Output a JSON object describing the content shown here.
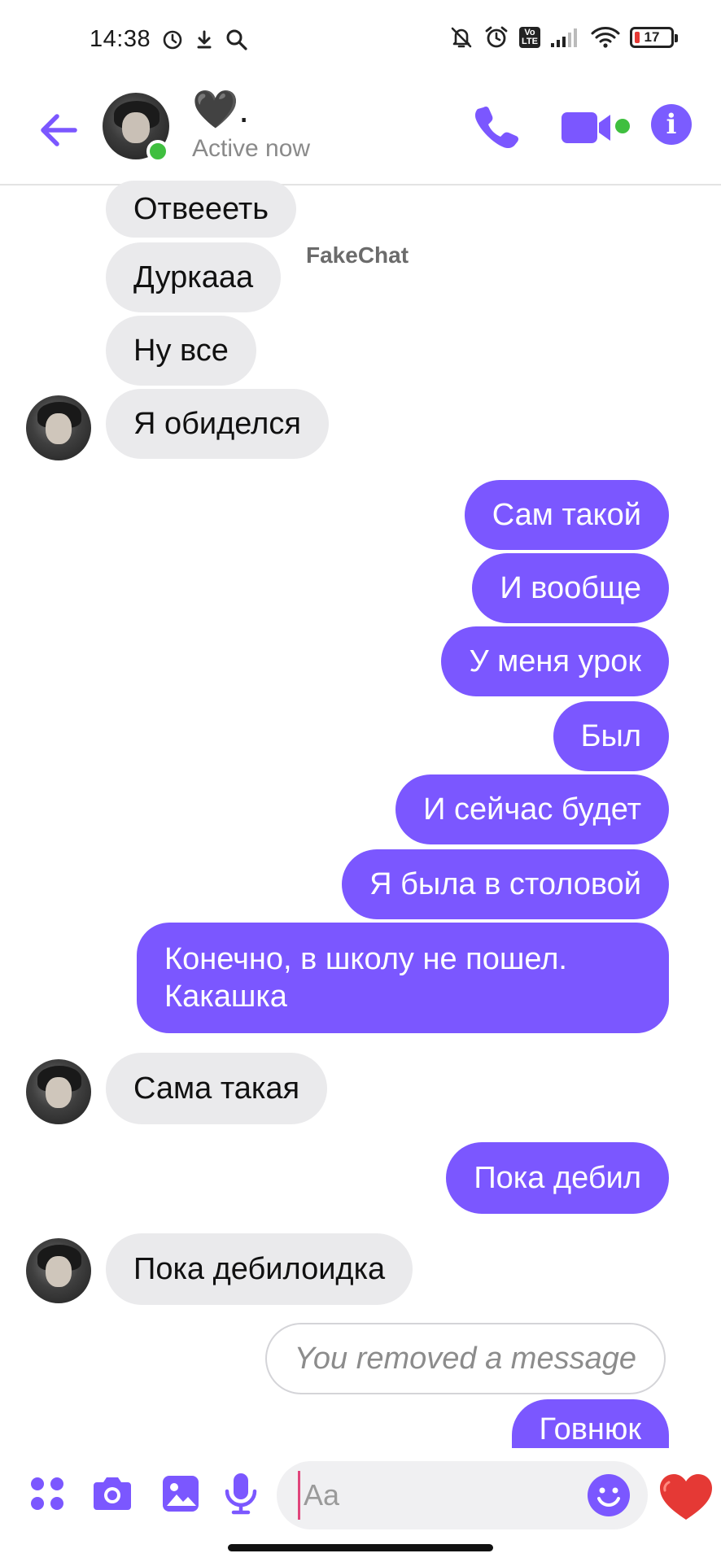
{
  "status_bar": {
    "time": "14:38",
    "battery": "17"
  },
  "header": {
    "contact_name": "🖤.",
    "contact_status": "Active now",
    "watermark": "FakeChat"
  },
  "colors": {
    "accent": "#7b57ff",
    "incoming_bubble": "#eaeaec",
    "online": "#3fbf3f"
  },
  "messages": [
    {
      "side": "in",
      "text": "Отвеееть"
    },
    {
      "side": "in",
      "text": "Дуркааа"
    },
    {
      "side": "in",
      "text": "Ну все"
    },
    {
      "side": "in",
      "text": "Я обиделся",
      "avatar": true
    },
    {
      "side": "out",
      "text": "Сам такой"
    },
    {
      "side": "out",
      "text": "И вообще"
    },
    {
      "side": "out",
      "text": "У меня урок"
    },
    {
      "side": "out",
      "text": "Был"
    },
    {
      "side": "out",
      "text": "И сейчас будет"
    },
    {
      "side": "out",
      "text": "Я была в столовой"
    },
    {
      "side": "out",
      "text": "Конечно, в школу не пошел.\nКакашка"
    },
    {
      "side": "in",
      "text": "Сама такая",
      "avatar": true
    },
    {
      "side": "out",
      "text": "Пока дебил"
    },
    {
      "side": "in",
      "text": "Пока дебилоидка",
      "avatar": true
    },
    {
      "side": "removed",
      "text": "You removed a message"
    },
    {
      "side": "out",
      "text": "Говнюк"
    }
  ],
  "composer": {
    "placeholder": "Aa",
    "icons": [
      "apps-icon",
      "camera-icon",
      "gallery-icon",
      "microphone-icon",
      "emoji-icon",
      "heart-icon"
    ]
  }
}
